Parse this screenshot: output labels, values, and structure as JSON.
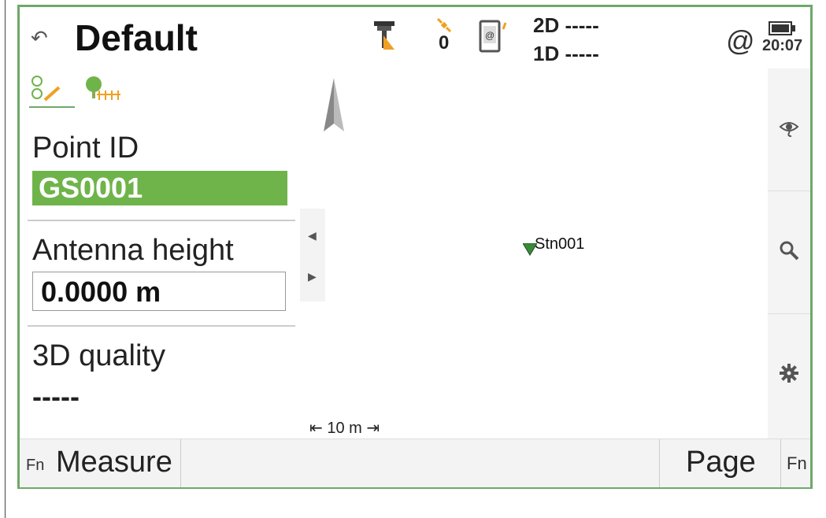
{
  "header": {
    "title": "Default",
    "satellites": "0",
    "quality_2d": "2D -----",
    "quality_1d": "1D -----",
    "connection_symbol": "@",
    "time": "20:07"
  },
  "form": {
    "point_id_label": "Point ID",
    "point_id_value": "GS0001",
    "antenna_height_label": "Antenna height",
    "antenna_height_value": "0.0000 m",
    "quality_3d_label": "3D quality",
    "quality_3d_value": "-----"
  },
  "map": {
    "station_label": "Stn001",
    "scale_label": "10 m"
  },
  "softkeys": {
    "fn_left": "Fn",
    "measure": "Measure",
    "page": "Page",
    "fn_right": "Fn"
  },
  "icons": [
    "back-icon",
    "antenna-icon",
    "satellite-icon",
    "device-icon",
    "battery-icon",
    "north-arrow-icon",
    "eye-icon",
    "search-icon",
    "gear-icon",
    "station-icon"
  ],
  "colors": {
    "accent": "#6fb44a",
    "frame": "#6fa86a"
  }
}
